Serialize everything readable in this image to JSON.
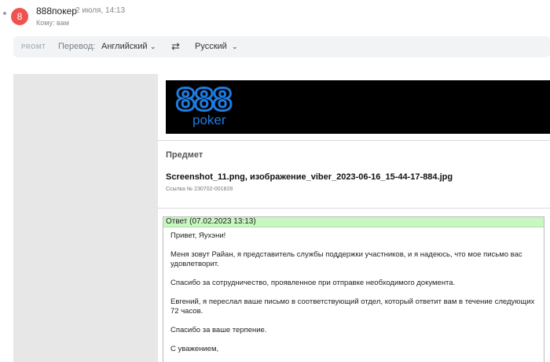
{
  "header": {
    "avatar_letter": "8",
    "sender": "888покер",
    "date": "2 июля, 14:13",
    "recipient": "Кому: вам"
  },
  "translate_bar": {
    "logo": "PROMT",
    "label": "Перевод:",
    "source_lang": "Английский",
    "target_lang": "Русский"
  },
  "email": {
    "logo_brand": "888",
    "logo_sub": "poker",
    "section_title": "Предмет",
    "subject": "Screenshot_11.png, изображение_viber_2023-06-16_15-44-17-884.jpg",
    "ticket": "Ссылка № 230702-001828",
    "reply_header": "Ответ (07.02.2023 13:13)",
    "reply_paragraphs": [
      "Привет, Яухэни!",
      "Меня зовут Райан, я представитель службы поддержки участников, и я надеюсь, что мое письмо вас удовлетворит.",
      "Спасибо за сотрудничество, проявленное при отправке необходимого документа.",
      "Евгений, я переслал ваше письмо в соответствующий отдел, который ответит вам в течение следующих 72 часов.",
      "Спасибо за ваше терпение.",
      "С уважением,"
    ]
  }
}
